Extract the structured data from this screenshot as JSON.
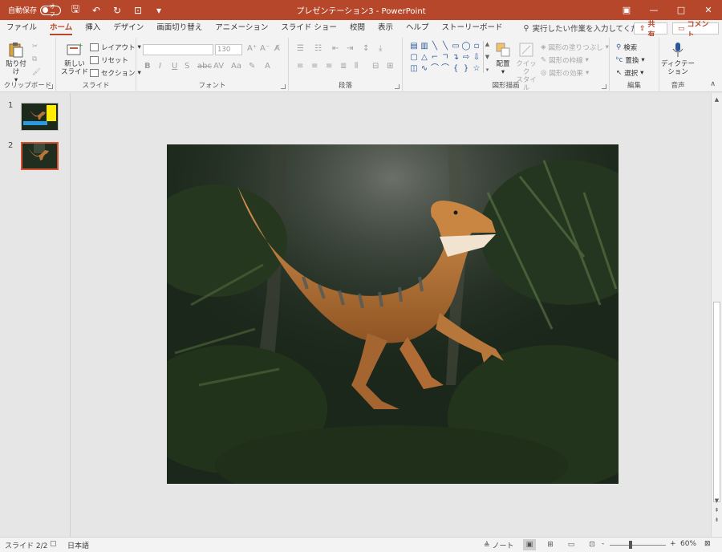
{
  "titlebar": {
    "autosave_label": "自動保存",
    "autosave_state": "オフ",
    "title": "プレゼンテーション3 - PowerPoint",
    "accent": "#b7472a"
  },
  "tabs": [
    "ファイル",
    "ホーム",
    "挿入",
    "デザイン",
    "画面切り替え",
    "アニメーション",
    "スライド ショー",
    "校閲",
    "表示",
    "ヘルプ",
    "ストーリーボード"
  ],
  "active_tab": "ホーム",
  "tellme": "実行したい作業を入力してください",
  "share_label": "共有",
  "comment_label": "コメント",
  "ribbon": {
    "clipboard": {
      "label": "クリップボード",
      "paste": "貼り付け"
    },
    "slides": {
      "label": "スライド",
      "new_slide_1": "新しい",
      "new_slide_2": "スライド",
      "layout": "レイアウト",
      "reset": "リセット",
      "section": "セクション"
    },
    "font": {
      "label": "フォント",
      "size": "130"
    },
    "paragraph": {
      "label": "段落"
    },
    "drawing": {
      "label": "図形描画",
      "arrange": "配置",
      "quick_style_1": "クイック",
      "quick_style_2": "スタイル",
      "fill": "図形の塗りつぶし",
      "outline": "図形の枠線",
      "effects": "図形の効果"
    },
    "editing": {
      "label": "編集",
      "find": "検索",
      "replace": "置換",
      "select": "選択"
    },
    "voice": {
      "label": "音声",
      "dictate_1": "ディクテー",
      "dictate_2": "ション"
    }
  },
  "slides": [
    {
      "number": "1",
      "selected": false
    },
    {
      "number": "2",
      "selected": true
    }
  ],
  "status": {
    "slide_info": "スライド 2/2",
    "language": "日本語",
    "notes": "ノート",
    "zoom": "60%",
    "zoom_minus": "-",
    "zoom_plus": "+"
  }
}
